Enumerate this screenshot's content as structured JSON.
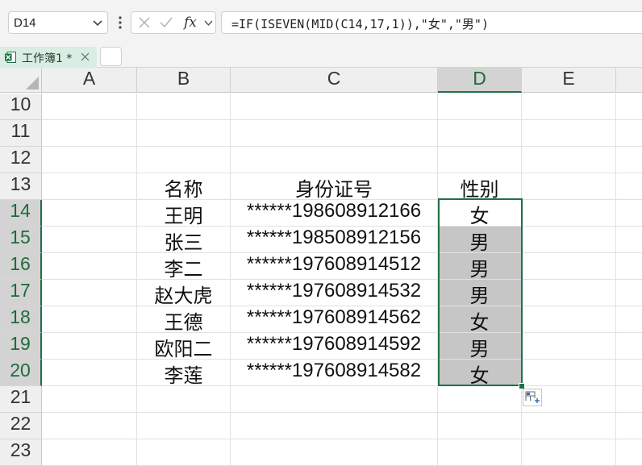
{
  "formula_bar": {
    "name_box": "D14",
    "formula": "=IF(ISEVEN(MID(C14,17,1)),\"女\",\"男\")"
  },
  "tabs": {
    "workbook_label": "工作簿1 *"
  },
  "sheet": {
    "columns": [
      "A",
      "B",
      "C",
      "D",
      "E"
    ],
    "rows": [
      "10",
      "11",
      "12",
      "13",
      "14",
      "15",
      "16",
      "17",
      "18",
      "19",
      "20",
      "21",
      "22",
      "23"
    ],
    "selected_column": "D",
    "selected_rows": [
      "14",
      "15",
      "16",
      "17",
      "18",
      "19",
      "20"
    ],
    "active_cell": "D14",
    "table": {
      "headers": {
        "name": "名称",
        "id": "身份证号",
        "gender": "性别"
      },
      "records": [
        {
          "name": "王明",
          "id": "******198608912166",
          "gender": "女"
        },
        {
          "name": "张三",
          "id": "******198508912156",
          "gender": "男"
        },
        {
          "name": "李二",
          "id": "******197608914512",
          "gender": "男"
        },
        {
          "name": "赵大虎",
          "id": "******197608914532",
          "gender": "男"
        },
        {
          "name": "王德",
          "id": "******197608914562",
          "gender": "女"
        },
        {
          "name": "欧阳二",
          "id": "******197608914592",
          "gender": "男"
        },
        {
          "name": "李莲",
          "id": "******197608914582",
          "gender": "女"
        }
      ]
    }
  },
  "colors": {
    "accent_green": "#1e7145",
    "selection_fill": "#c6c6c6",
    "header_bg": "#efefef"
  },
  "icons": {
    "name_box_dropdown": "chevron-down-icon",
    "more": "more-vertical-icon",
    "cancel": "cancel-x-icon",
    "enter": "checkmark-icon",
    "insert_function": "fx-icon",
    "workbook": "excel-file-icon",
    "close_tab": "close-icon",
    "select_all": "select-all-triangle-icon",
    "quick_analysis": "quick-analysis-icon"
  }
}
